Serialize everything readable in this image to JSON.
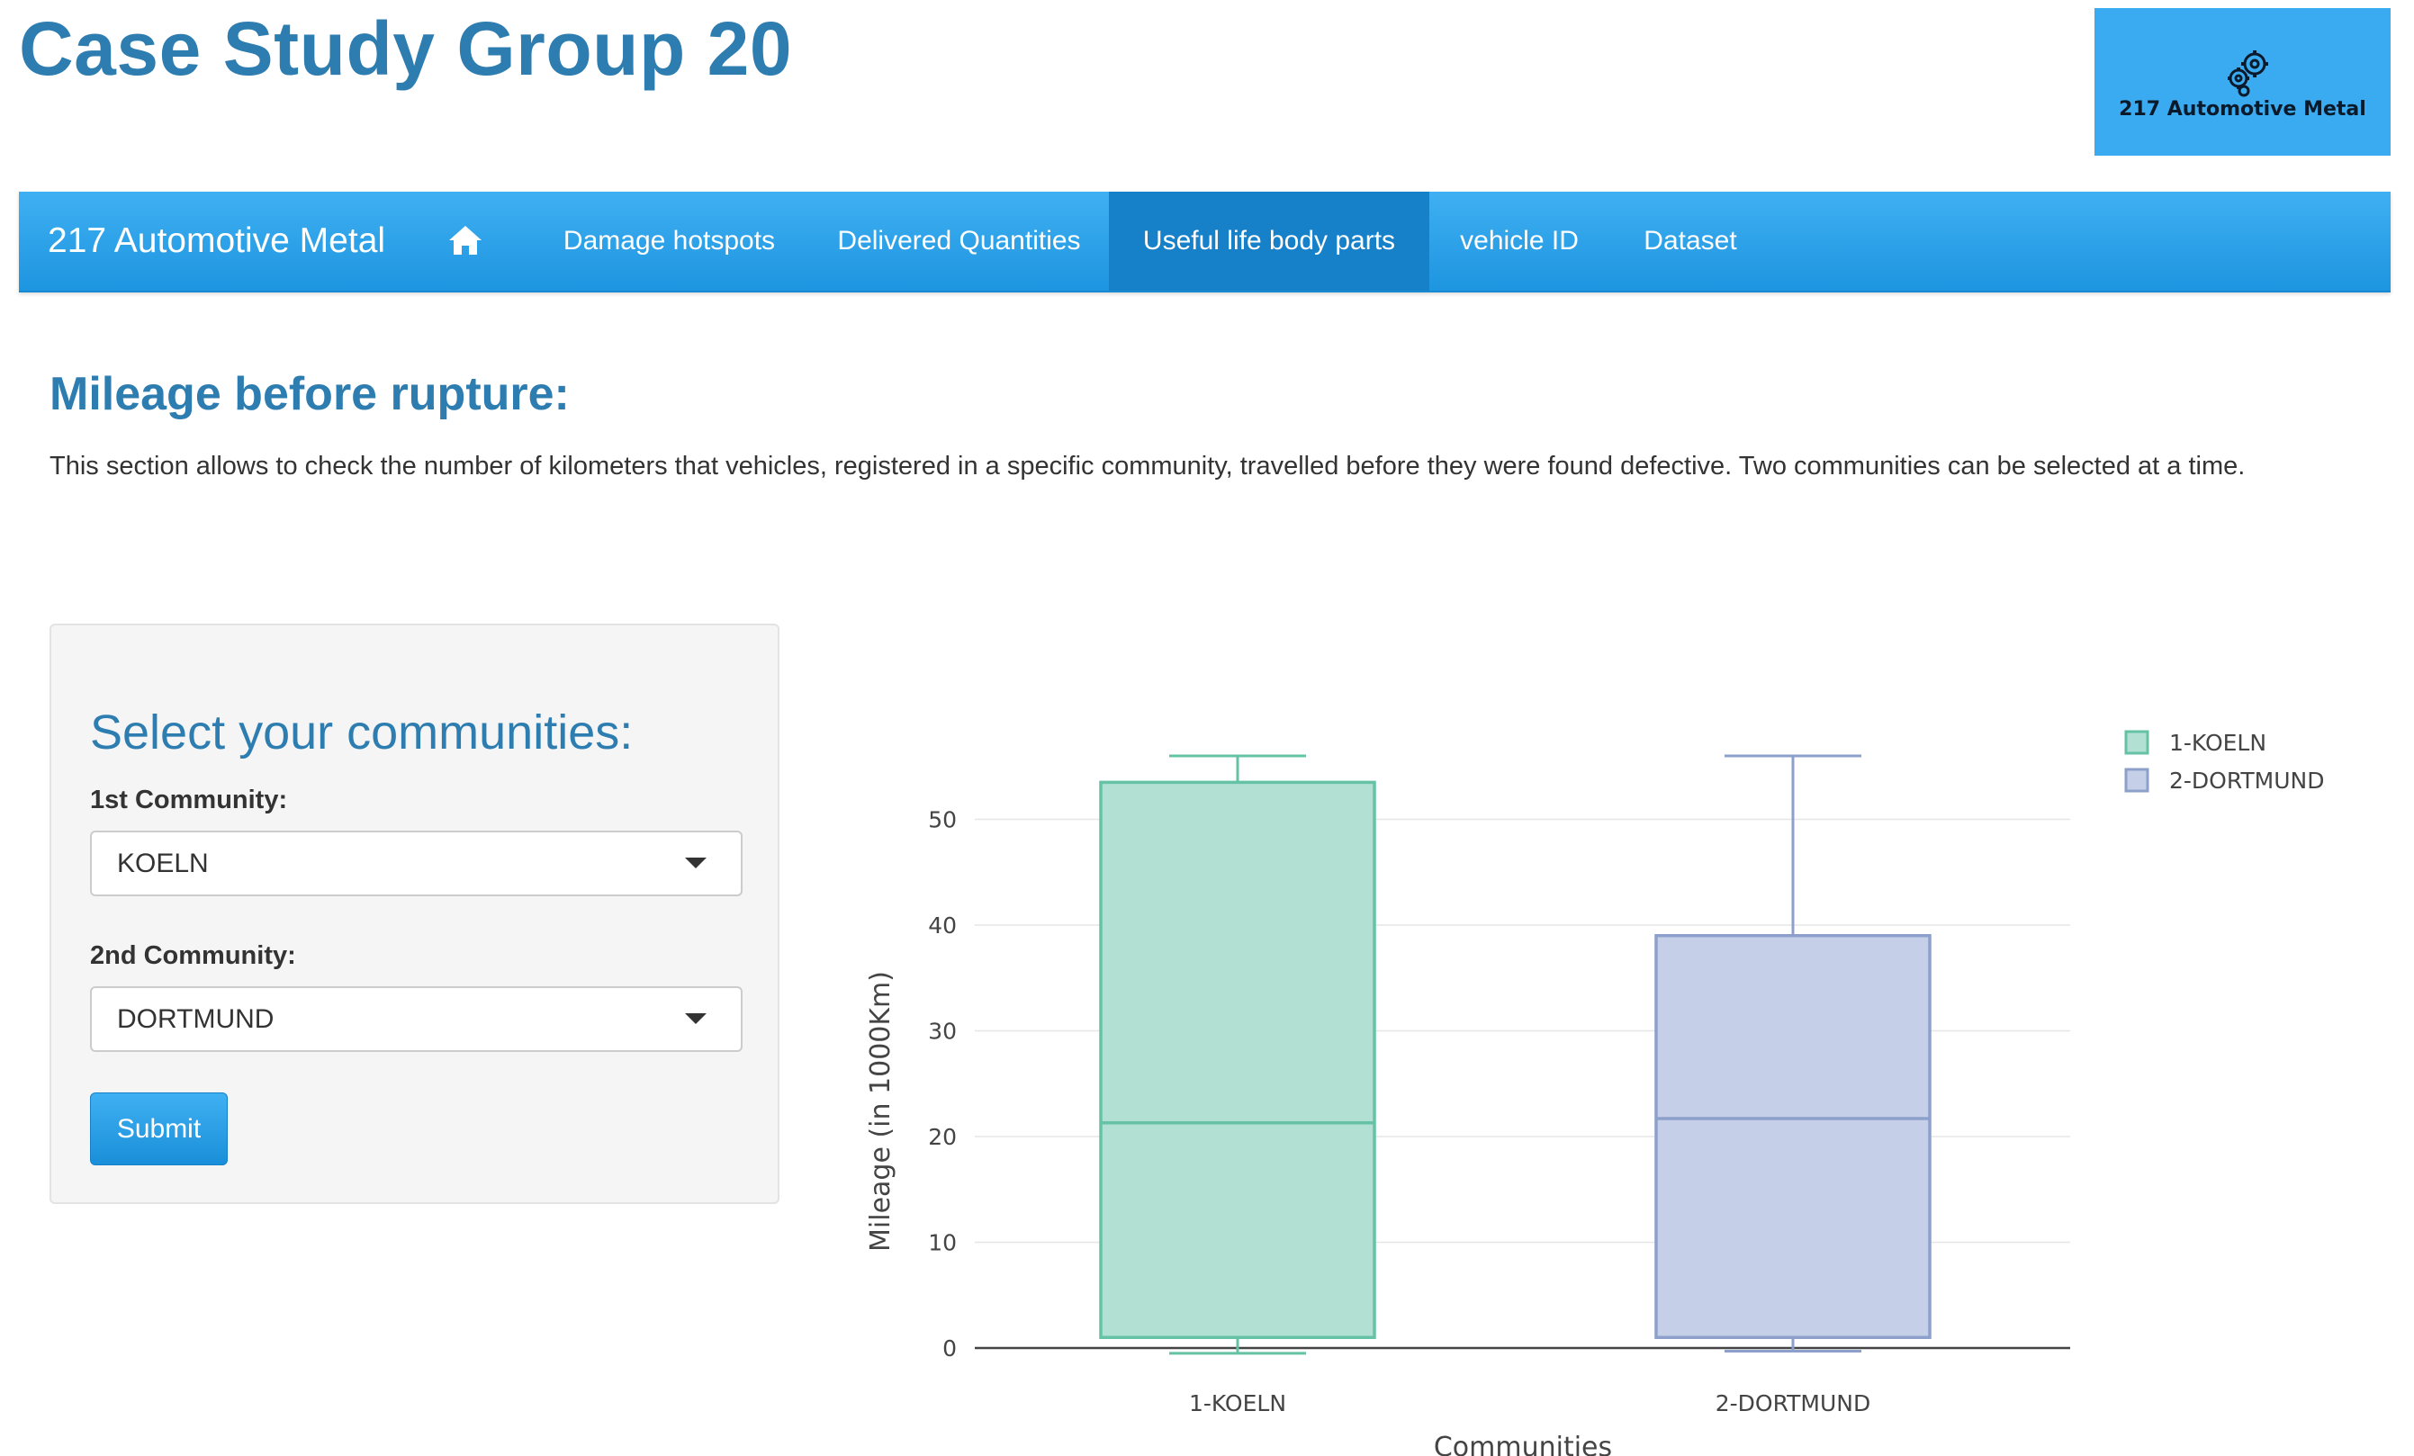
{
  "page": {
    "title": "Case Study Group 20"
  },
  "logo": {
    "text": "217 Automotive Metal",
    "icon": "gears-icon"
  },
  "navbar": {
    "brand": "217 Automotive Metal",
    "home_icon": "home-icon",
    "items": [
      {
        "label": "Damage hotspots",
        "active": false
      },
      {
        "label": "Delivered Quantities",
        "active": false
      },
      {
        "label": "Useful life body parts",
        "active": true
      },
      {
        "label": "vehicle ID",
        "active": false
      },
      {
        "label": "Dataset",
        "active": false
      }
    ],
    "colors": {
      "bar": "#2aa3ec",
      "active": "#1680c8"
    }
  },
  "section": {
    "title": "Mileage before rupture:",
    "description": "This section allows to check the number of kilometers that vehicles, registered in a specific community, travelled before they were found defective. Two communities can be selected at a time."
  },
  "sidebar": {
    "title": "Select your communities:",
    "field1": {
      "label": "1st Community:",
      "value": "KOELN"
    },
    "field2": {
      "label": "2nd Community:",
      "value": "DORTMUND"
    },
    "submit_label": "Submit"
  },
  "chart_data": {
    "type": "box",
    "xlabel": "Communities",
    "ylabel": "Mileage (in 1000Km)",
    "ylim": [
      -1,
      57
    ],
    "yticks": [
      0,
      10,
      20,
      30,
      40,
      50
    ],
    "grid": true,
    "legend_position": "top-right",
    "series": [
      {
        "name": "1-KOELN",
        "category": "1-KOELN",
        "min": -0.5,
        "q1": 1,
        "median": 21.3,
        "q3": 53.5,
        "max": 56,
        "stroke": "#66c2a5",
        "fill": "#b2e0d2"
      },
      {
        "name": "2-DORTMUND",
        "category": "2-DORTMUND",
        "min": -0.3,
        "q1": 1,
        "median": 21.7,
        "q3": 39,
        "max": 56,
        "stroke": "#8da0cb",
        "fill": "#c6cfe8"
      }
    ]
  }
}
